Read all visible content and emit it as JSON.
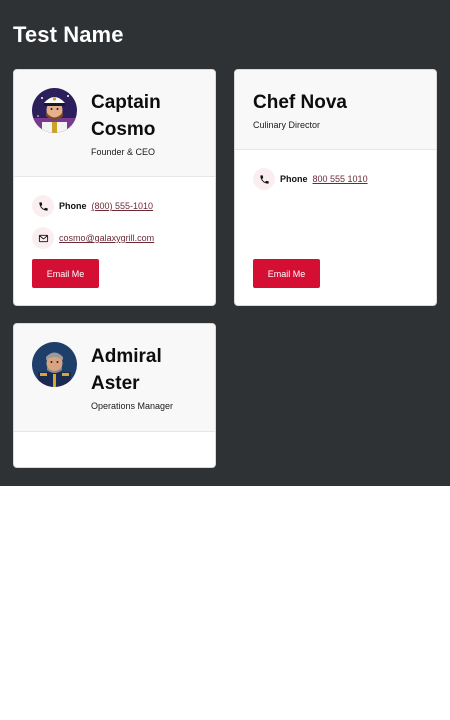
{
  "section": {
    "title": "Test Name"
  },
  "cards": [
    {
      "name_line1": "Captain",
      "name_line2": "Cosmo",
      "role": "Founder & CEO",
      "phone_label": "Phone",
      "phone": "(800) 555-1010",
      "email": "cosmo@galaxygrill.com",
      "button_label": "Email Me"
    },
    {
      "name": "Chef Nova",
      "role": "Culinary Director",
      "phone_label": "Phone",
      "phone": "800 555 1010",
      "button_label": "Email Me"
    },
    {
      "name_line1": "Admiral",
      "name_line2": "Aster",
      "role": "Operations Manager"
    }
  ],
  "colors": {
    "accent": "#d50f33",
    "section_bg": "#2f3234",
    "link": "#6b2a36"
  }
}
